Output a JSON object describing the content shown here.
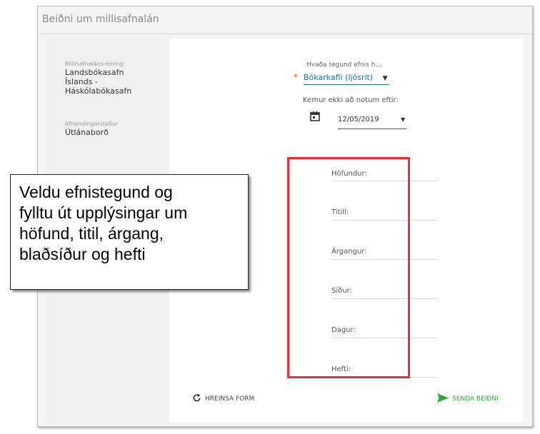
{
  "window": {
    "title": "Beiðni um millisafnalán"
  },
  "left": {
    "unit_label": "Millisafnaláns-eining:",
    "unit_value": [
      "Landsbókasafn",
      "Íslands -",
      "Háskólabókasafn"
    ],
    "delivery_label": "Afhendingarstaður",
    "delivery_value": "Útlánaborð"
  },
  "form": {
    "material_type_label": "Hvaða tegund efnis h...",
    "material_type_value": "Bókarkafli (ljósrit)",
    "not_needed_after_label": "Kemur ekki að notum eftir:",
    "date_value": "12/05/2019",
    "fields": [
      {
        "label": "Höfundur:"
      },
      {
        "label": "Titill:"
      },
      {
        "label": "Árgangur:"
      },
      {
        "label": "Síður:"
      },
      {
        "label": "Dagur:"
      },
      {
        "label": "Hefti:"
      }
    ]
  },
  "actions": {
    "reset_label": "HREINSA FORM",
    "send_label": "SENDA BEIÐNI"
  },
  "callout": {
    "lines": [
      "Veldu efnistegund og",
      "fylltu út upplýsingar um",
      "höfund, titil, árgang,",
      "blaðsíður og hefti"
    ]
  },
  "colors": {
    "accent": "#1b6f7a",
    "required": "#e05a1a",
    "highlight": "#e53238",
    "send": "#2eaa3a"
  },
  "icons": {
    "calendar": "calendar-icon",
    "reset": "refresh-icon",
    "send": "send-icon",
    "dropdown": "caret-down-icon"
  }
}
